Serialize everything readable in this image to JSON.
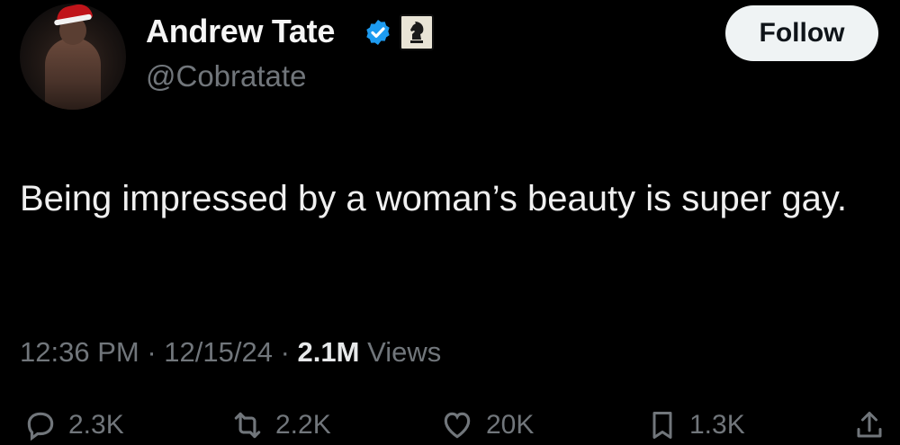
{
  "tweet": {
    "display_name": "Andrew Tate",
    "handle": "@Cobratate",
    "follow_label": "Follow",
    "text": "Being impressed by a woman’s beauty is super gay.",
    "time": "12:36 PM",
    "date": "12/15/24",
    "views_count": "2.1M",
    "views_label": "Views",
    "sep": "·"
  },
  "actions": {
    "replies": "2.3K",
    "reposts": "2.2K",
    "likes": "20K",
    "bookmarks": "1.3K"
  },
  "icons": {
    "avatar": "avatar-image",
    "verified": "verified-badge-icon",
    "affiliate": "affiliate-badge-icon",
    "reply": "reply-icon",
    "repost": "repost-icon",
    "like": "heart-icon",
    "bookmark": "bookmark-icon",
    "share": "share-icon"
  },
  "colors": {
    "background": "#000000",
    "text": "#e7e9ea",
    "muted": "#71767b",
    "verified": "#1d9bf0",
    "follow_bg": "#eff3f4"
  }
}
